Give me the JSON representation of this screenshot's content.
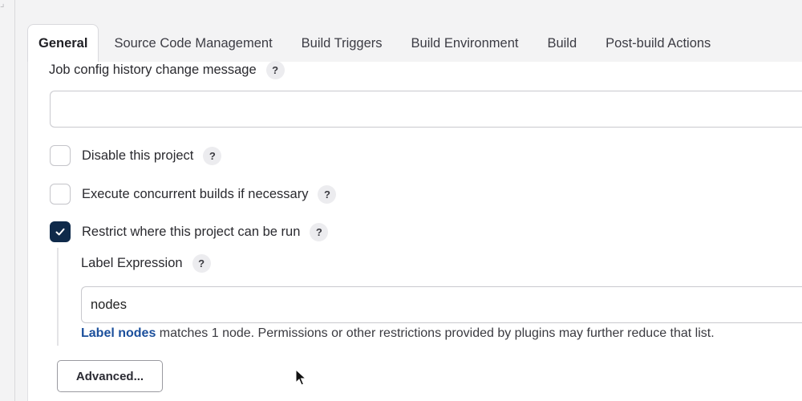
{
  "tabs": [
    {
      "label": "General",
      "active": true
    },
    {
      "label": "Source Code Management"
    },
    {
      "label": "Build Triggers"
    },
    {
      "label": "Build Environment"
    },
    {
      "label": "Build"
    },
    {
      "label": "Post-build Actions"
    }
  ],
  "form": {
    "history_message": {
      "label": "Job config history change message",
      "value": ""
    },
    "disable_project": {
      "label": "Disable this project",
      "checked": false
    },
    "concurrent_builds": {
      "label": "Execute concurrent builds if necessary",
      "checked": false
    },
    "restrict_run": {
      "label": "Restrict where this project can be run",
      "checked": true
    },
    "label_expression": {
      "label": "Label Expression",
      "value": "nodes",
      "hint_link": "Label nodes",
      "hint_text": " matches 1 node. Permissions or other restrictions provided by plugins may further reduce that list."
    },
    "help_glyph": "?",
    "advanced_button": "Advanced..."
  },
  "icons": {
    "help": "help-icon",
    "check": "check-icon",
    "cursor": "mouse-cursor-icon"
  },
  "colors": {
    "checked_fill": "#0f2a4a",
    "link": "#1b4f9c",
    "background": "#f3f3f4"
  }
}
